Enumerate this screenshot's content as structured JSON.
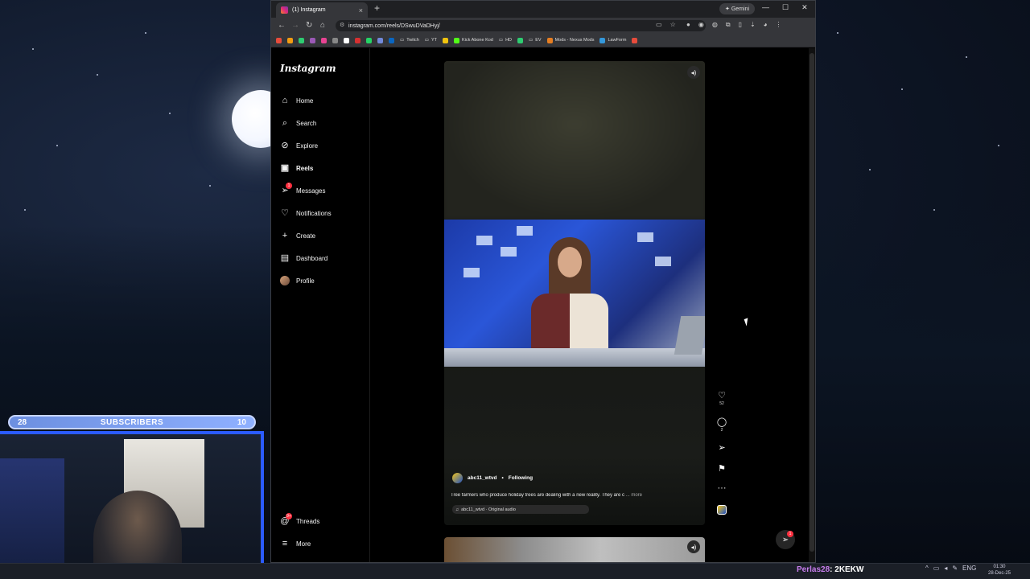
{
  "desktop": {
    "subscribers": {
      "left_count": "28",
      "title": "SUBSCRIBERS",
      "right_count": "10"
    },
    "taskbar": {
      "chat_user": "Perlas28",
      "chat_message": ": 2KEKW",
      "lang": "ENG",
      "time": "01:30",
      "date": "28-Dec-25"
    }
  },
  "browser": {
    "tab_title": "(1) Instagram",
    "gemini_label": "Gemini",
    "url": "instagram.com/reels/DSwuDVaDHyj/",
    "bookmarks": [
      "Twitch",
      "YT",
      "Kick Abone Kod",
      "HD",
      "EV",
      "Mods - Nexus Mods",
      "LawForm"
    ]
  },
  "instagram": {
    "logo": "Instagram",
    "nav": [
      {
        "label": "Home",
        "icon": "home-icon"
      },
      {
        "label": "Search",
        "icon": "search-icon"
      },
      {
        "label": "Explore",
        "icon": "explore-icon"
      },
      {
        "label": "Reels",
        "icon": "reels-icon"
      },
      {
        "label": "Messages",
        "icon": "messages-icon",
        "badge": "1"
      },
      {
        "label": "Notifications",
        "icon": "heart-icon"
      },
      {
        "label": "Create",
        "icon": "plus-icon"
      },
      {
        "label": "Dashboard",
        "icon": "dashboard-icon"
      },
      {
        "label": "Profile",
        "icon": "avatar-icon"
      }
    ],
    "bottom_nav": [
      {
        "label": "Threads",
        "icon": "threads-icon",
        "badge": "9+"
      },
      {
        "label": "More",
        "icon": "menu-icon"
      }
    ],
    "reel": {
      "username": "abc11_wtvd",
      "separator": "•",
      "follow_state": "Following",
      "caption": "Tree farmers who produce holiday trees are dealing with a new reality. They are c",
      "caption_more": "... more",
      "audio": "abc11_wtvd · Original audio",
      "likes": "52",
      "comments": "2"
    },
    "messages_badge": "1"
  }
}
